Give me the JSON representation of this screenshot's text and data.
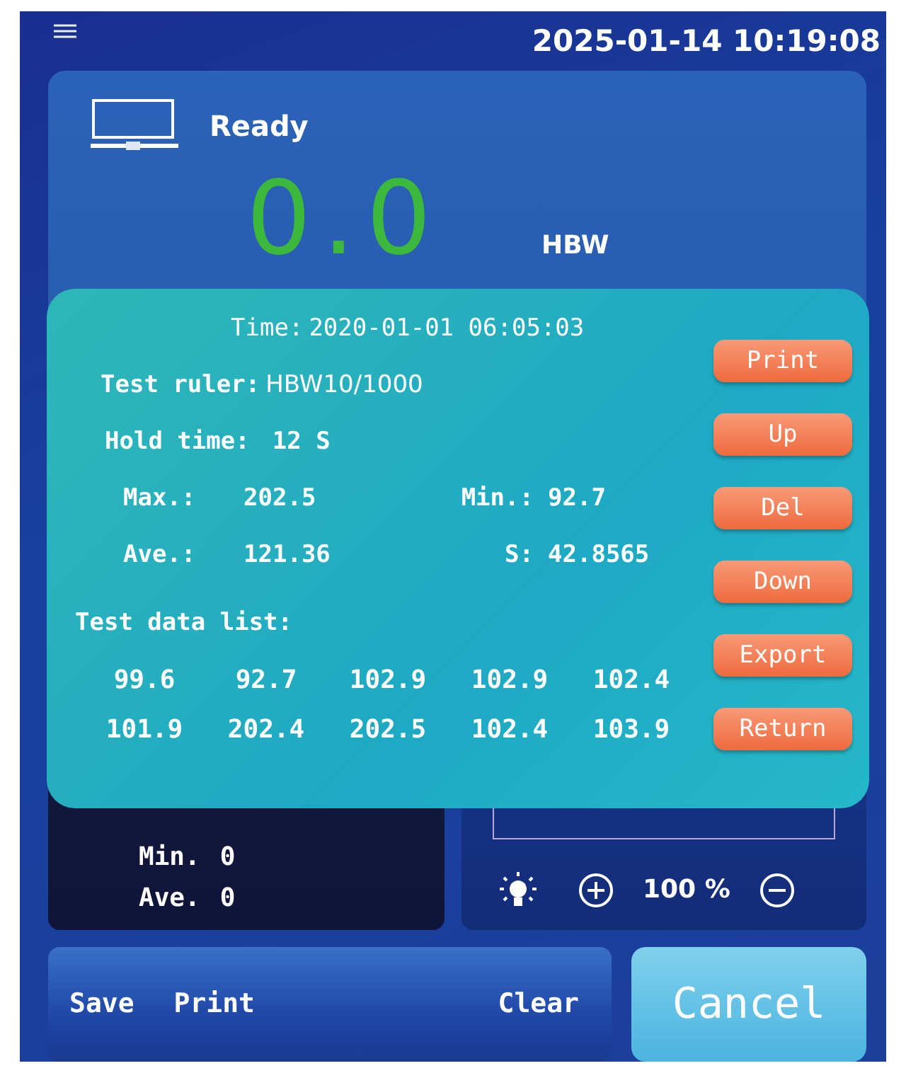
{
  "header": {
    "datetime": "2025-01-14  10:19:08"
  },
  "status": {
    "text": "Ready"
  },
  "reading": {
    "value": "0.0",
    "scale": "HBW"
  },
  "stats": [
    {
      "label": "Min.",
      "value": "0"
    },
    {
      "label": "Ave.",
      "value": "0"
    }
  ],
  "brightness": {
    "value": "100 %"
  },
  "actions": [
    "Save",
    "Print",
    "Clear"
  ],
  "cancel": "Cancel",
  "dialog": {
    "time_label": "Time:",
    "time": "2020-01-01  06:05:03",
    "fields": [
      {
        "label": "Test ruler:",
        "value": "HBW10/1000"
      },
      {
        "label": "Hold time:",
        "value": "12  S"
      }
    ],
    "stats": [
      {
        "label": "Max.:",
        "value": "202.5"
      },
      {
        "label": "Min.:",
        "value": "92.7"
      },
      {
        "label": "Ave.:",
        "value": "121.36"
      },
      {
        "label": "S:",
        "value": "42.8565"
      }
    ],
    "list_label": "Test data list:",
    "data": [
      "99.6",
      "92.7",
      "102.9",
      "102.9",
      "102.4",
      "101.9",
      "202.4",
      "202.5",
      "102.4",
      "103.9"
    ],
    "buttons": [
      "Print",
      "Up",
      "Del",
      "Down",
      "Export",
      "Return"
    ]
  }
}
